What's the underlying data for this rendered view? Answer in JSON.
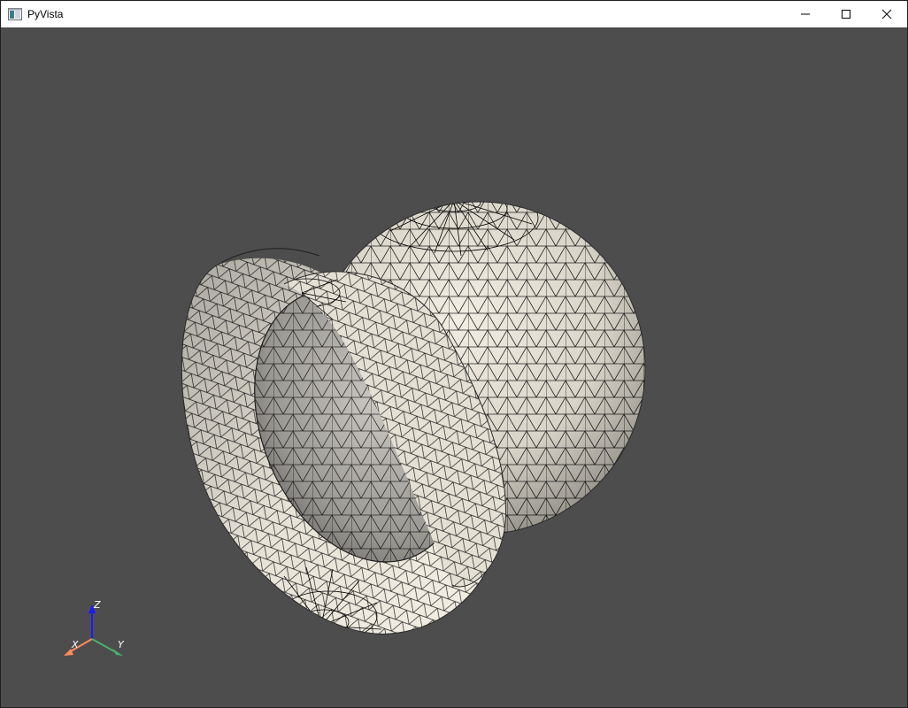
{
  "window": {
    "title": "PyVista",
    "controls": {
      "minimize": "minimize",
      "maximize": "maximize",
      "close": "close"
    }
  },
  "viewport": {
    "background": "#4d4d4d",
    "mesh_color": "#ece8dc",
    "edge_color": "#000000"
  },
  "axes": {
    "x_label": "X",
    "y_label": "Y",
    "z_label": "Z",
    "x_color": "#ff8a5c",
    "y_color": "#4caf6e",
    "z_color": "#1a1aff"
  }
}
